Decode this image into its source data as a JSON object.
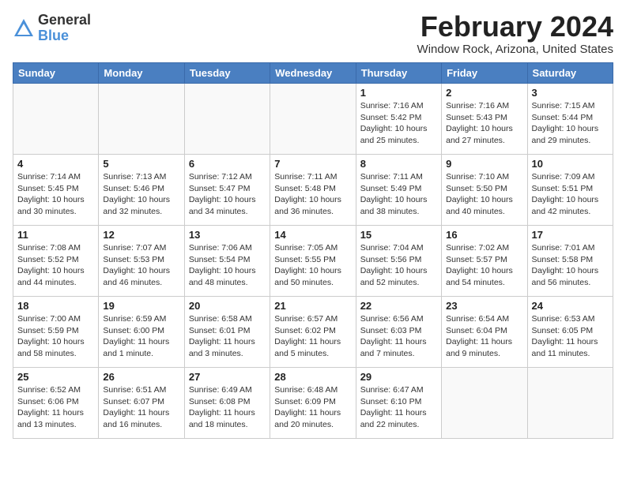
{
  "header": {
    "logo_general": "General",
    "logo_blue": "Blue",
    "month_title": "February 2024",
    "location": "Window Rock, Arizona, United States"
  },
  "weekdays": [
    "Sunday",
    "Monday",
    "Tuesday",
    "Wednesday",
    "Thursday",
    "Friday",
    "Saturday"
  ],
  "weeks": [
    [
      {
        "day": "",
        "info": ""
      },
      {
        "day": "",
        "info": ""
      },
      {
        "day": "",
        "info": ""
      },
      {
        "day": "",
        "info": ""
      },
      {
        "day": "1",
        "info": "Sunrise: 7:16 AM\nSunset: 5:42 PM\nDaylight: 10 hours\nand 25 minutes."
      },
      {
        "day": "2",
        "info": "Sunrise: 7:16 AM\nSunset: 5:43 PM\nDaylight: 10 hours\nand 27 minutes."
      },
      {
        "day": "3",
        "info": "Sunrise: 7:15 AM\nSunset: 5:44 PM\nDaylight: 10 hours\nand 29 minutes."
      }
    ],
    [
      {
        "day": "4",
        "info": "Sunrise: 7:14 AM\nSunset: 5:45 PM\nDaylight: 10 hours\nand 30 minutes."
      },
      {
        "day": "5",
        "info": "Sunrise: 7:13 AM\nSunset: 5:46 PM\nDaylight: 10 hours\nand 32 minutes."
      },
      {
        "day": "6",
        "info": "Sunrise: 7:12 AM\nSunset: 5:47 PM\nDaylight: 10 hours\nand 34 minutes."
      },
      {
        "day": "7",
        "info": "Sunrise: 7:11 AM\nSunset: 5:48 PM\nDaylight: 10 hours\nand 36 minutes."
      },
      {
        "day": "8",
        "info": "Sunrise: 7:11 AM\nSunset: 5:49 PM\nDaylight: 10 hours\nand 38 minutes."
      },
      {
        "day": "9",
        "info": "Sunrise: 7:10 AM\nSunset: 5:50 PM\nDaylight: 10 hours\nand 40 minutes."
      },
      {
        "day": "10",
        "info": "Sunrise: 7:09 AM\nSunset: 5:51 PM\nDaylight: 10 hours\nand 42 minutes."
      }
    ],
    [
      {
        "day": "11",
        "info": "Sunrise: 7:08 AM\nSunset: 5:52 PM\nDaylight: 10 hours\nand 44 minutes."
      },
      {
        "day": "12",
        "info": "Sunrise: 7:07 AM\nSunset: 5:53 PM\nDaylight: 10 hours\nand 46 minutes."
      },
      {
        "day": "13",
        "info": "Sunrise: 7:06 AM\nSunset: 5:54 PM\nDaylight: 10 hours\nand 48 minutes."
      },
      {
        "day": "14",
        "info": "Sunrise: 7:05 AM\nSunset: 5:55 PM\nDaylight: 10 hours\nand 50 minutes."
      },
      {
        "day": "15",
        "info": "Sunrise: 7:04 AM\nSunset: 5:56 PM\nDaylight: 10 hours\nand 52 minutes."
      },
      {
        "day": "16",
        "info": "Sunrise: 7:02 AM\nSunset: 5:57 PM\nDaylight: 10 hours\nand 54 minutes."
      },
      {
        "day": "17",
        "info": "Sunrise: 7:01 AM\nSunset: 5:58 PM\nDaylight: 10 hours\nand 56 minutes."
      }
    ],
    [
      {
        "day": "18",
        "info": "Sunrise: 7:00 AM\nSunset: 5:59 PM\nDaylight: 10 hours\nand 58 minutes."
      },
      {
        "day": "19",
        "info": "Sunrise: 6:59 AM\nSunset: 6:00 PM\nDaylight: 11 hours\nand 1 minute."
      },
      {
        "day": "20",
        "info": "Sunrise: 6:58 AM\nSunset: 6:01 PM\nDaylight: 11 hours\nand 3 minutes."
      },
      {
        "day": "21",
        "info": "Sunrise: 6:57 AM\nSunset: 6:02 PM\nDaylight: 11 hours\nand 5 minutes."
      },
      {
        "day": "22",
        "info": "Sunrise: 6:56 AM\nSunset: 6:03 PM\nDaylight: 11 hours\nand 7 minutes."
      },
      {
        "day": "23",
        "info": "Sunrise: 6:54 AM\nSunset: 6:04 PM\nDaylight: 11 hours\nand 9 minutes."
      },
      {
        "day": "24",
        "info": "Sunrise: 6:53 AM\nSunset: 6:05 PM\nDaylight: 11 hours\nand 11 minutes."
      }
    ],
    [
      {
        "day": "25",
        "info": "Sunrise: 6:52 AM\nSunset: 6:06 PM\nDaylight: 11 hours\nand 13 minutes."
      },
      {
        "day": "26",
        "info": "Sunrise: 6:51 AM\nSunset: 6:07 PM\nDaylight: 11 hours\nand 16 minutes."
      },
      {
        "day": "27",
        "info": "Sunrise: 6:49 AM\nSunset: 6:08 PM\nDaylight: 11 hours\nand 18 minutes."
      },
      {
        "day": "28",
        "info": "Sunrise: 6:48 AM\nSunset: 6:09 PM\nDaylight: 11 hours\nand 20 minutes."
      },
      {
        "day": "29",
        "info": "Sunrise: 6:47 AM\nSunset: 6:10 PM\nDaylight: 11 hours\nand 22 minutes."
      },
      {
        "day": "",
        "info": ""
      },
      {
        "day": "",
        "info": ""
      }
    ]
  ]
}
